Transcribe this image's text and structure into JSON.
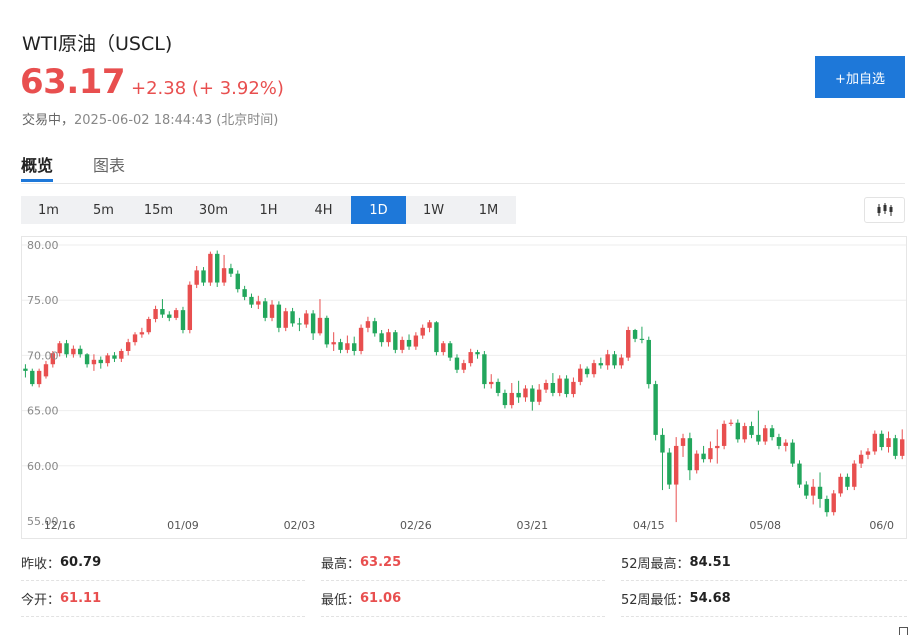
{
  "header": {
    "title": "WTI原油（USCL)",
    "price": "63.17",
    "change": "+2.38 (+ 3.92%)",
    "status": "交易中，",
    "timestamp": "2025-06-02 18:44:43 (北京时间)",
    "follow_label": "+加自选"
  },
  "tabs": [
    "概览",
    "图表"
  ],
  "intervals": [
    "1m",
    "5m",
    "15m",
    "30m",
    "1H",
    "4H",
    "1D",
    "1W",
    "1M"
  ],
  "active_interval": "1D",
  "colors": {
    "up": "#e84f4f",
    "down": "#22a65c",
    "accent": "#1e78d9"
  },
  "chart_data": {
    "type": "candlestick",
    "ylim": [
      55,
      80
    ],
    "yticks": [
      "80.00",
      "75.00",
      "70.00",
      "65.00",
      "60.00",
      "55.00"
    ],
    "xticks": [
      "12/16",
      "01/09",
      "02/03",
      "02/26",
      "03/21",
      "04/15",
      "05/08",
      "06/0"
    ],
    "xtick_index": [
      5,
      23,
      40,
      57,
      74,
      91,
      108,
      125
    ],
    "candles": [
      [
        68.8,
        68.6,
        68.0,
        69.2
      ],
      [
        68.6,
        67.4,
        67.2,
        68.8
      ],
      [
        67.4,
        68.6,
        67.1,
        68.8
      ],
      [
        68.1,
        69.2,
        67.9,
        69.5
      ],
      [
        69.2,
        70.2,
        68.9,
        70.4
      ],
      [
        70.2,
        71.1,
        69.9,
        71.3
      ],
      [
        71.1,
        70.1,
        69.8,
        71.4
      ],
      [
        70.1,
        70.6,
        69.8,
        70.9
      ],
      [
        70.6,
        70.1,
        69.8,
        70.9
      ],
      [
        70.1,
        69.2,
        68.9,
        70.2
      ],
      [
        69.2,
        69.6,
        68.6,
        70.1
      ],
      [
        69.6,
        69.3,
        68.8,
        69.9
      ],
      [
        69.3,
        70.0,
        69.0,
        70.2
      ],
      [
        70.0,
        69.7,
        69.4,
        70.3
      ],
      [
        69.7,
        70.4,
        69.4,
        70.6
      ],
      [
        70.4,
        71.2,
        70.0,
        71.5
      ],
      [
        71.2,
        71.9,
        70.9,
        72.1
      ],
      [
        71.9,
        72.1,
        71.6,
        72.5
      ],
      [
        72.1,
        73.3,
        71.9,
        73.5
      ],
      [
        73.3,
        74.2,
        73.0,
        74.5
      ],
      [
        74.2,
        73.7,
        73.4,
        75.1
      ],
      [
        73.7,
        73.4,
        73.1,
        74.0
      ],
      [
        73.4,
        74.1,
        73.2,
        74.3
      ],
      [
        74.1,
        72.3,
        72.0,
        74.4
      ],
      [
        72.3,
        76.4,
        72.0,
        76.7
      ],
      [
        76.4,
        77.7,
        76.1,
        78.1
      ],
      [
        77.7,
        76.6,
        76.3,
        78.0
      ],
      [
        76.6,
        79.2,
        76.3,
        79.4
      ],
      [
        79.2,
        76.6,
        76.2,
        79.5
      ],
      [
        76.6,
        77.9,
        76.3,
        79.1
      ],
      [
        77.9,
        77.4,
        77.1,
        78.3
      ],
      [
        77.4,
        76.0,
        75.7,
        77.7
      ],
      [
        76.0,
        75.3,
        75.0,
        76.3
      ],
      [
        75.3,
        74.6,
        74.3,
        75.6
      ],
      [
        74.6,
        74.9,
        74.2,
        75.4
      ],
      [
        74.9,
        73.4,
        73.1,
        75.2
      ],
      [
        73.4,
        74.6,
        73.1,
        75.0
      ],
      [
        74.6,
        72.5,
        72.1,
        74.9
      ],
      [
        72.5,
        74.0,
        72.2,
        74.3
      ],
      [
        74.0,
        72.9,
        72.6,
        74.3
      ],
      [
        72.9,
        72.8,
        72.2,
        73.4
      ],
      [
        72.8,
        73.8,
        72.5,
        74.1
      ],
      [
        73.8,
        72.0,
        71.4,
        74.1
      ],
      [
        72.0,
        73.4,
        71.8,
        75.1
      ],
      [
        73.4,
        71.0,
        70.7,
        73.6
      ],
      [
        71.0,
        71.2,
        70.4,
        72.1
      ],
      [
        71.2,
        70.5,
        70.2,
        71.5
      ],
      [
        70.5,
        71.1,
        70.2,
        71.8
      ],
      [
        71.1,
        70.4,
        70.0,
        71.7
      ],
      [
        70.4,
        72.5,
        70.1,
        72.8
      ],
      [
        72.5,
        73.1,
        72.1,
        73.5
      ],
      [
        73.1,
        72.0,
        71.7,
        73.4
      ],
      [
        72.0,
        71.2,
        70.8,
        72.3
      ],
      [
        71.2,
        72.1,
        70.8,
        72.4
      ],
      [
        72.1,
        70.5,
        70.2,
        72.3
      ],
      [
        70.5,
        71.4,
        70.2,
        71.7
      ],
      [
        71.4,
        70.8,
        70.5,
        71.9
      ],
      [
        70.8,
        71.8,
        70.5,
        72.1
      ],
      [
        71.8,
        72.5,
        71.5,
        72.8
      ],
      [
        72.5,
        73.0,
        72.1,
        73.2
      ],
      [
        73.0,
        70.3,
        70.0,
        73.1
      ],
      [
        70.3,
        71.1,
        70.0,
        71.3
      ],
      [
        71.1,
        69.8,
        69.5,
        71.3
      ],
      [
        69.8,
        68.7,
        68.4,
        70.1
      ],
      [
        68.7,
        69.3,
        68.4,
        69.6
      ],
      [
        69.3,
        70.3,
        69.0,
        70.6
      ],
      [
        70.3,
        70.1,
        69.7,
        70.5
      ],
      [
        70.1,
        67.4,
        67.0,
        70.4
      ],
      [
        67.4,
        67.6,
        67.0,
        68.3
      ],
      [
        67.6,
        66.6,
        66.3,
        67.9
      ],
      [
        66.6,
        65.5,
        65.2,
        66.9
      ],
      [
        65.5,
        66.6,
        65.2,
        67.5
      ],
      [
        66.6,
        66.2,
        65.7,
        67.7
      ],
      [
        66.2,
        67.0,
        65.8,
        67.3
      ],
      [
        67.0,
        65.8,
        65.0,
        67.3
      ],
      [
        65.8,
        66.9,
        65.5,
        67.4
      ],
      [
        66.9,
        67.5,
        66.6,
        67.8
      ],
      [
        67.5,
        66.6,
        66.3,
        68.4
      ],
      [
        66.6,
        67.9,
        66.3,
        68.2
      ],
      [
        67.9,
        66.5,
        66.2,
        68.2
      ],
      [
        66.5,
        67.6,
        66.2,
        68.0
      ],
      [
        67.6,
        68.8,
        67.3,
        69.2
      ],
      [
        68.8,
        68.3,
        68.0,
        69.0
      ],
      [
        68.3,
        69.3,
        68.0,
        69.6
      ],
      [
        69.3,
        69.1,
        68.8,
        69.8
      ],
      [
        69.1,
        70.1,
        68.7,
        70.5
      ],
      [
        70.1,
        69.1,
        68.8,
        70.4
      ],
      [
        69.1,
        69.8,
        68.8,
        70.1
      ],
      [
        69.8,
        72.3,
        69.5,
        72.6
      ],
      [
        72.3,
        71.5,
        71.2,
        72.4
      ],
      [
        71.5,
        71.4,
        71.1,
        72.6
      ],
      [
        71.4,
        67.4,
        67.0,
        71.7
      ],
      [
        67.4,
        62.8,
        62.3,
        67.7
      ],
      [
        62.8,
        61.2,
        57.8,
        63.4
      ],
      [
        61.2,
        58.3,
        57.9,
        61.6
      ],
      [
        58.3,
        61.8,
        54.9,
        62.6
      ],
      [
        61.8,
        62.5,
        60.8,
        62.9
      ],
      [
        62.5,
        59.6,
        58.7,
        63.0
      ],
      [
        59.6,
        61.1,
        59.3,
        61.4
      ],
      [
        61.1,
        60.6,
        60.3,
        61.8
      ],
      [
        60.6,
        61.6,
        60.3,
        62.2
      ],
      [
        61.6,
        61.8,
        60.2,
        63.3
      ],
      [
        61.8,
        63.8,
        61.5,
        64.1
      ],
      [
        63.8,
        63.9,
        63.6,
        64.2
      ],
      [
        63.9,
        62.4,
        62.1,
        64.2
      ],
      [
        62.4,
        63.6,
        62.1,
        63.9
      ],
      [
        63.6,
        62.8,
        62.5,
        64.0
      ],
      [
        62.8,
        62.2,
        61.9,
        65.0
      ],
      [
        62.2,
        63.4,
        61.9,
        63.7
      ],
      [
        63.4,
        62.6,
        62.3,
        63.7
      ],
      [
        62.6,
        61.8,
        61.5,
        62.9
      ],
      [
        61.8,
        62.1,
        61.3,
        62.4
      ],
      [
        62.1,
        60.2,
        59.9,
        62.4
      ],
      [
        60.2,
        58.3,
        58.0,
        60.5
      ],
      [
        58.3,
        57.3,
        57.0,
        58.6
      ],
      [
        57.3,
        58.1,
        56.5,
        58.8
      ],
      [
        58.1,
        57.0,
        56.2,
        59.4
      ],
      [
        57.0,
        55.8,
        55.4,
        57.3
      ],
      [
        55.8,
        57.5,
        55.5,
        57.8
      ],
      [
        57.5,
        59.0,
        57.2,
        59.3
      ],
      [
        59.0,
        58.1,
        57.8,
        59.3
      ],
      [
        58.1,
        60.2,
        57.8,
        60.5
      ],
      [
        60.2,
        61.0,
        59.8,
        61.4
      ],
      [
        61.0,
        61.3,
        60.6,
        61.6
      ],
      [
        61.3,
        62.9,
        61.0,
        63.2
      ],
      [
        62.9,
        61.7,
        61.4,
        63.2
      ],
      [
        61.7,
        62.5,
        61.2,
        63.1
      ],
      [
        62.5,
        60.9,
        60.6,
        62.8
      ],
      [
        60.9,
        62.4,
        60.6,
        63.3
      ],
      [
        62.4,
        61.6,
        61.3,
        62.7
      ],
      [
        61.6,
        61.0,
        60.7,
        63.0
      ],
      [
        61.0,
        61.8,
        60.7,
        62.1
      ],
      [
        61.8,
        62.0,
        61.5,
        62.3
      ],
      [
        62.0,
        61.1,
        60.8,
        62.3
      ],
      [
        61.1,
        61.9,
        60.8,
        62.2
      ],
      [
        61.9,
        60.3,
        60.0,
        62.5
      ],
      [
        60.3,
        61.4,
        60.0,
        61.7
      ],
      [
        61.4,
        61.7,
        61.1,
        62.0
      ],
      [
        61.7,
        60.5,
        60.2,
        62.0
      ],
      [
        60.5,
        61.1,
        59.9,
        61.4
      ],
      [
        61.1,
        60.5,
        60.2,
        61.4
      ],
      [
        60.5,
        61.1,
        59.8,
        62.4
      ],
      [
        61.1,
        60.2,
        59.9,
        61.3
      ],
      [
        60.8,
        63.2,
        60.5,
        63.4
      ]
    ]
  },
  "stats": [
    {
      "label": "昨收：",
      "value": "60.79",
      "red": false
    },
    {
      "label": "最高：",
      "value": "63.25",
      "red": true
    },
    {
      "label": "52周最高：",
      "value": "84.51",
      "red": false
    },
    {
      "label": "今开：",
      "value": "61.11",
      "red": true
    },
    {
      "label": "最低：",
      "value": "61.06",
      "red": true
    },
    {
      "label": "52周最低：",
      "value": "54.68",
      "red": false
    }
  ]
}
